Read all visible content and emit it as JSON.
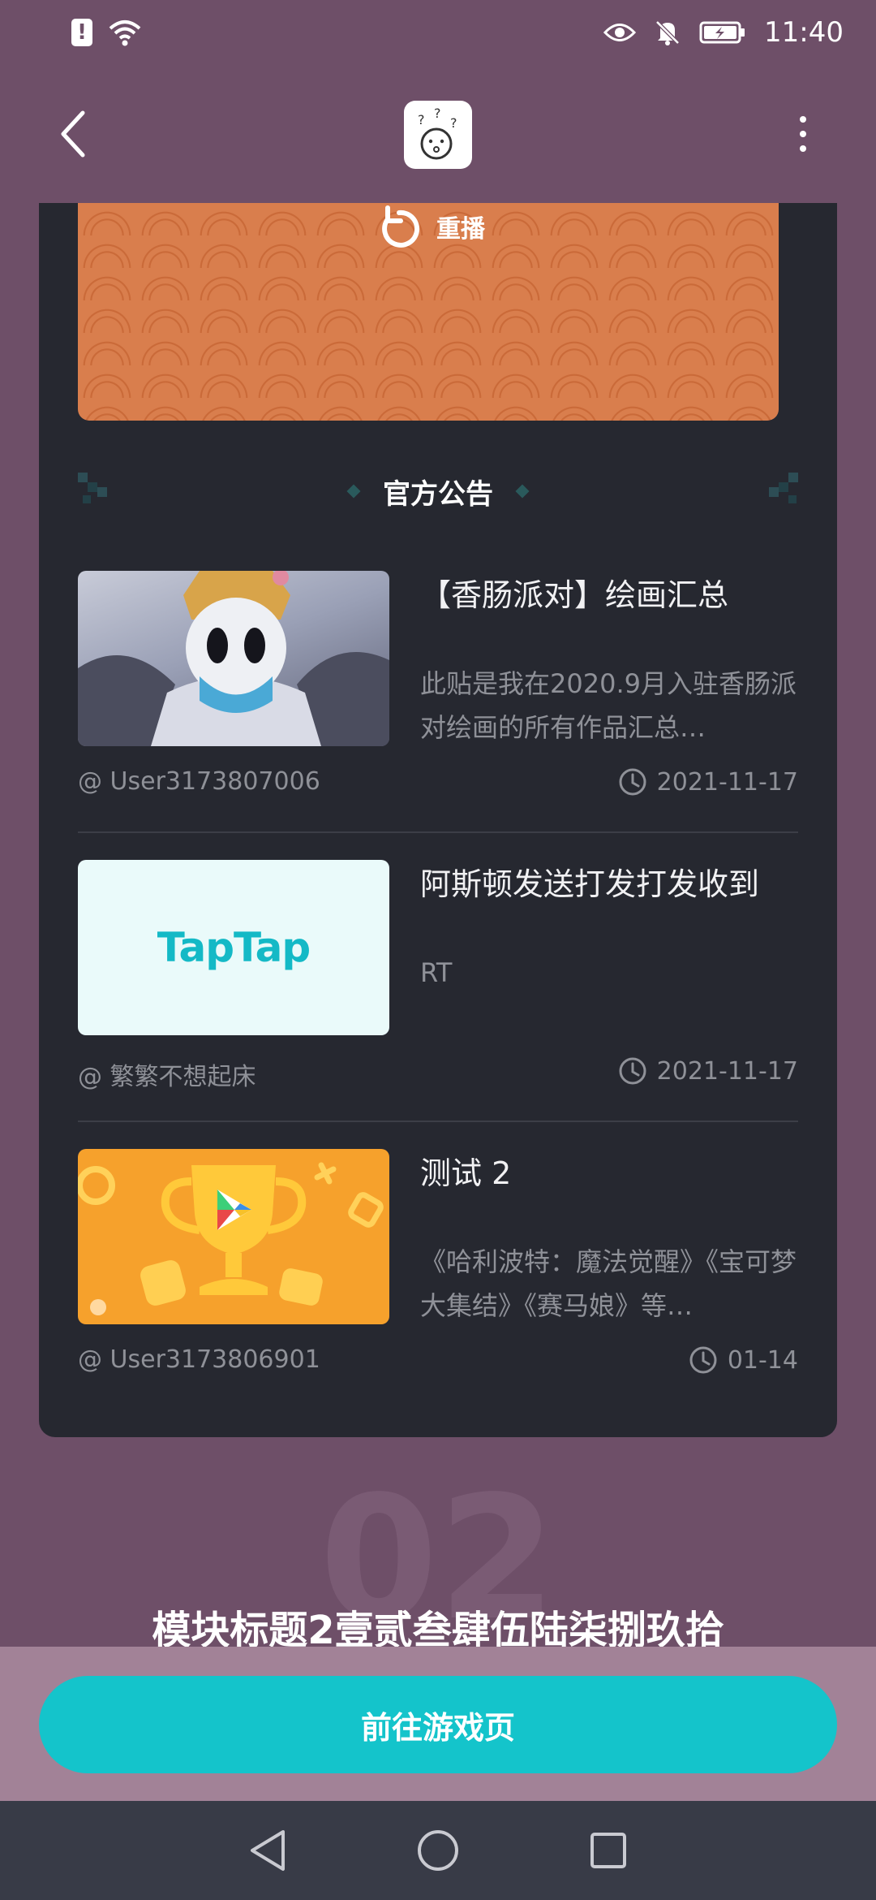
{
  "status_bar": {
    "time": "11:40",
    "left_icons": [
      "alert-icon",
      "wifi-icon"
    ],
    "right_icons": [
      "eye-icon",
      "bell-mute-icon",
      "battery-charging-icon"
    ]
  },
  "top_nav": {
    "back_icon": "chevron-left-icon",
    "logo_icon": "confused-face-icon",
    "more_icon": "more-vertical-icon"
  },
  "video": {
    "replay_label": "重播"
  },
  "section": {
    "title": "官方公告"
  },
  "posts": [
    {
      "title": "【香肠派对】绘画汇总",
      "summary": "此贴是我在2020.9月入驻香肠派对绘画的所有作品汇总…",
      "author": "@ User3173807006",
      "date": "2021-11-17"
    },
    {
      "title": "阿斯顿发送打发打发收到",
      "summary": "RT",
      "author": "@ 繁繁不想起床",
      "date": "2021-11-17",
      "thumb_text": "TapTap"
    },
    {
      "title": "测试 2",
      "summary": "《哈利波特：魔法觉醒》《宝可梦大集结》《赛马娘》等…",
      "author": "@ User3173806901",
      "date": "01-14"
    }
  ],
  "module": {
    "number": "02",
    "title": "模块标题2壹贰叁肆伍陆柒捌玖拾"
  },
  "cta": {
    "label": "前往游戏页"
  },
  "colors": {
    "background": "#6e4f68",
    "card": "#262830",
    "accent": "#14c4cb",
    "bottom_bar": "#a28297"
  }
}
